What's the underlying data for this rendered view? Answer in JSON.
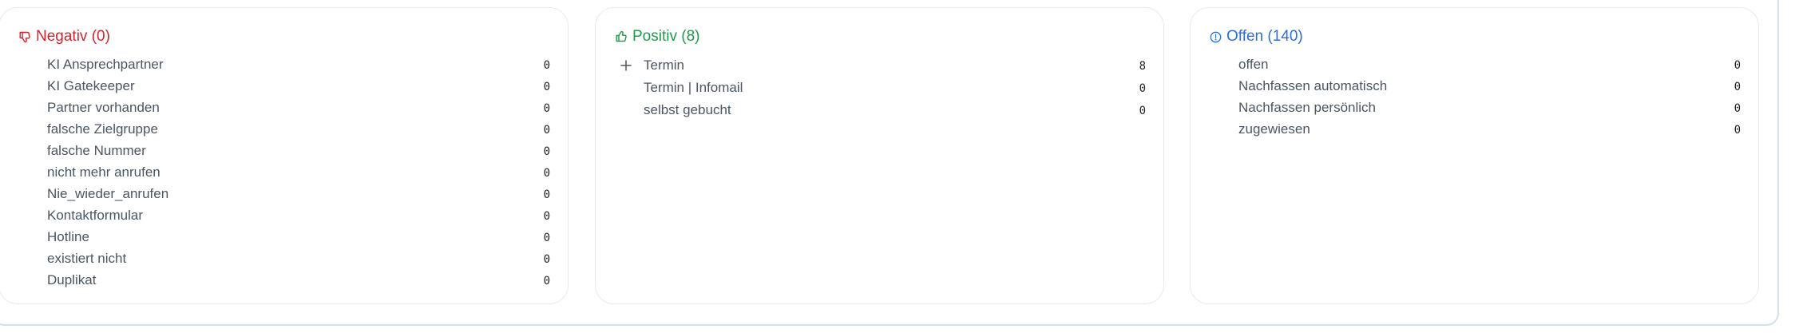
{
  "panels": {
    "negativ": {
      "title": "Negativ (0)",
      "icon": "thumbs-down-icon",
      "color": "#d3242e",
      "items": [
        {
          "label": "KI Ansprechpartner",
          "count": "0"
        },
        {
          "label": "KI Gatekeeper",
          "count": "0"
        },
        {
          "label": "Partner vorhanden",
          "count": "0"
        },
        {
          "label": "falsche Zielgruppe",
          "count": "0"
        },
        {
          "label": "falsche Nummer",
          "count": "0"
        },
        {
          "label": "nicht mehr anrufen",
          "count": "0"
        },
        {
          "label": "Nie_wieder_anrufen",
          "count": "0"
        },
        {
          "label": "Kontaktformular",
          "count": "0"
        },
        {
          "label": "Hotline",
          "count": "0"
        },
        {
          "label": "existiert nicht",
          "count": "0"
        },
        {
          "label": "Duplikat",
          "count": "0"
        }
      ]
    },
    "positiv": {
      "title": "Positiv (8)",
      "icon": "thumbs-up-icon",
      "color": "#1f9a4a",
      "items": [
        {
          "label": "Termin",
          "count": "8",
          "expandable": true,
          "expand_icon": "plus-icon"
        },
        {
          "label": "Termin | Infomail",
          "count": "0"
        },
        {
          "label": "selbst gebucht",
          "count": "0"
        }
      ]
    },
    "offen": {
      "title": "Offen (140)",
      "icon": "info-circle-icon",
      "color": "#2a6fdb",
      "items": [
        {
          "label": "offen",
          "count": "0"
        },
        {
          "label": "Nachfassen automatisch",
          "count": "0"
        },
        {
          "label": "Nachfassen persönlich",
          "count": "0"
        },
        {
          "label": "zugewiesen",
          "count": "0"
        }
      ]
    }
  }
}
